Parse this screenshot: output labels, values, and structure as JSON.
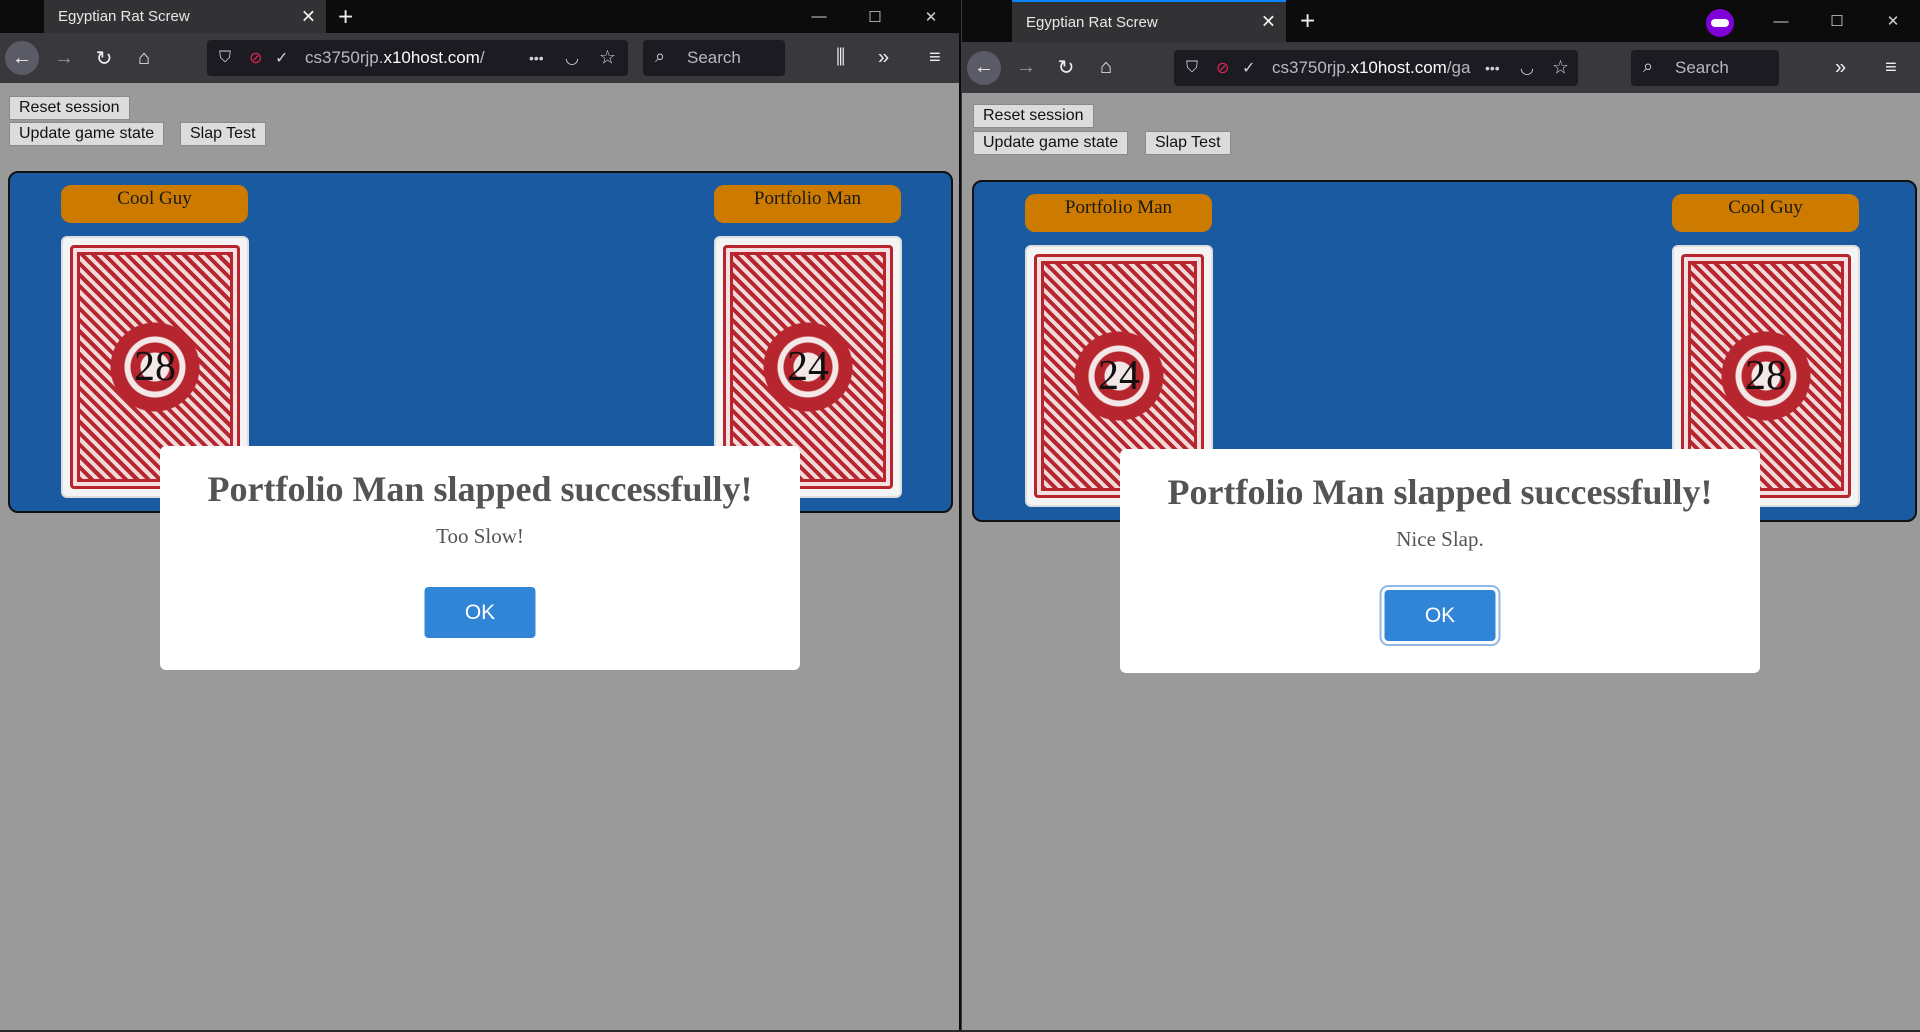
{
  "colors": {
    "chrome_dark": "#0c0c0d",
    "toolbar": "#38383d",
    "page_bg": "#9a9a9a",
    "board_bg": "#1a5aa0",
    "name_tag": "#cc7a00",
    "ok_button": "#3085d6",
    "private_purple": "#8000d7"
  },
  "windows": [
    {
      "tab_title": "Egyptian Rat Screw",
      "url_prefix": "cs3750rjp.",
      "url_host": "x10host.com",
      "url_rest": "/",
      "search_placeholder": "Search",
      "buttons": {
        "reset": "Reset session",
        "update": "Update game state",
        "slap": "Slap Test"
      },
      "players": [
        {
          "name": "Cool Guy",
          "cards": "28"
        },
        {
          "name": "Portfolio Man",
          "cards": "24"
        }
      ],
      "dialog": {
        "title": "Portfolio Man slapped successfully!",
        "message": "Too Slow!",
        "ok": "OK"
      }
    },
    {
      "tab_title": "Egyptian Rat Screw",
      "url_prefix": "cs3750rjp.",
      "url_host": "x10host.com",
      "url_rest": "/ga",
      "search_placeholder": "Search",
      "buttons": {
        "reset": "Reset session",
        "update": "Update game state",
        "slap": "Slap Test"
      },
      "players": [
        {
          "name": "Portfolio Man",
          "cards": "24"
        },
        {
          "name": "Cool Guy",
          "cards": "28"
        }
      ],
      "dialog": {
        "title": "Portfolio Man slapped successfully!",
        "message": "Nice Slap.",
        "ok": "OK"
      }
    }
  ],
  "icons": {
    "tab_close": "✕",
    "new_tab": "+",
    "minimize": "—",
    "maximize": "☐",
    "close": "✕",
    "back": "←",
    "forward": "→",
    "reload": "↻",
    "home": "⌂",
    "shield": "⛉",
    "page_actions": "•••",
    "pocket": "◡",
    "bookmark_star": "☆",
    "search": "⌕",
    "library": "⫼",
    "overflow": "»",
    "menu": "≡"
  }
}
